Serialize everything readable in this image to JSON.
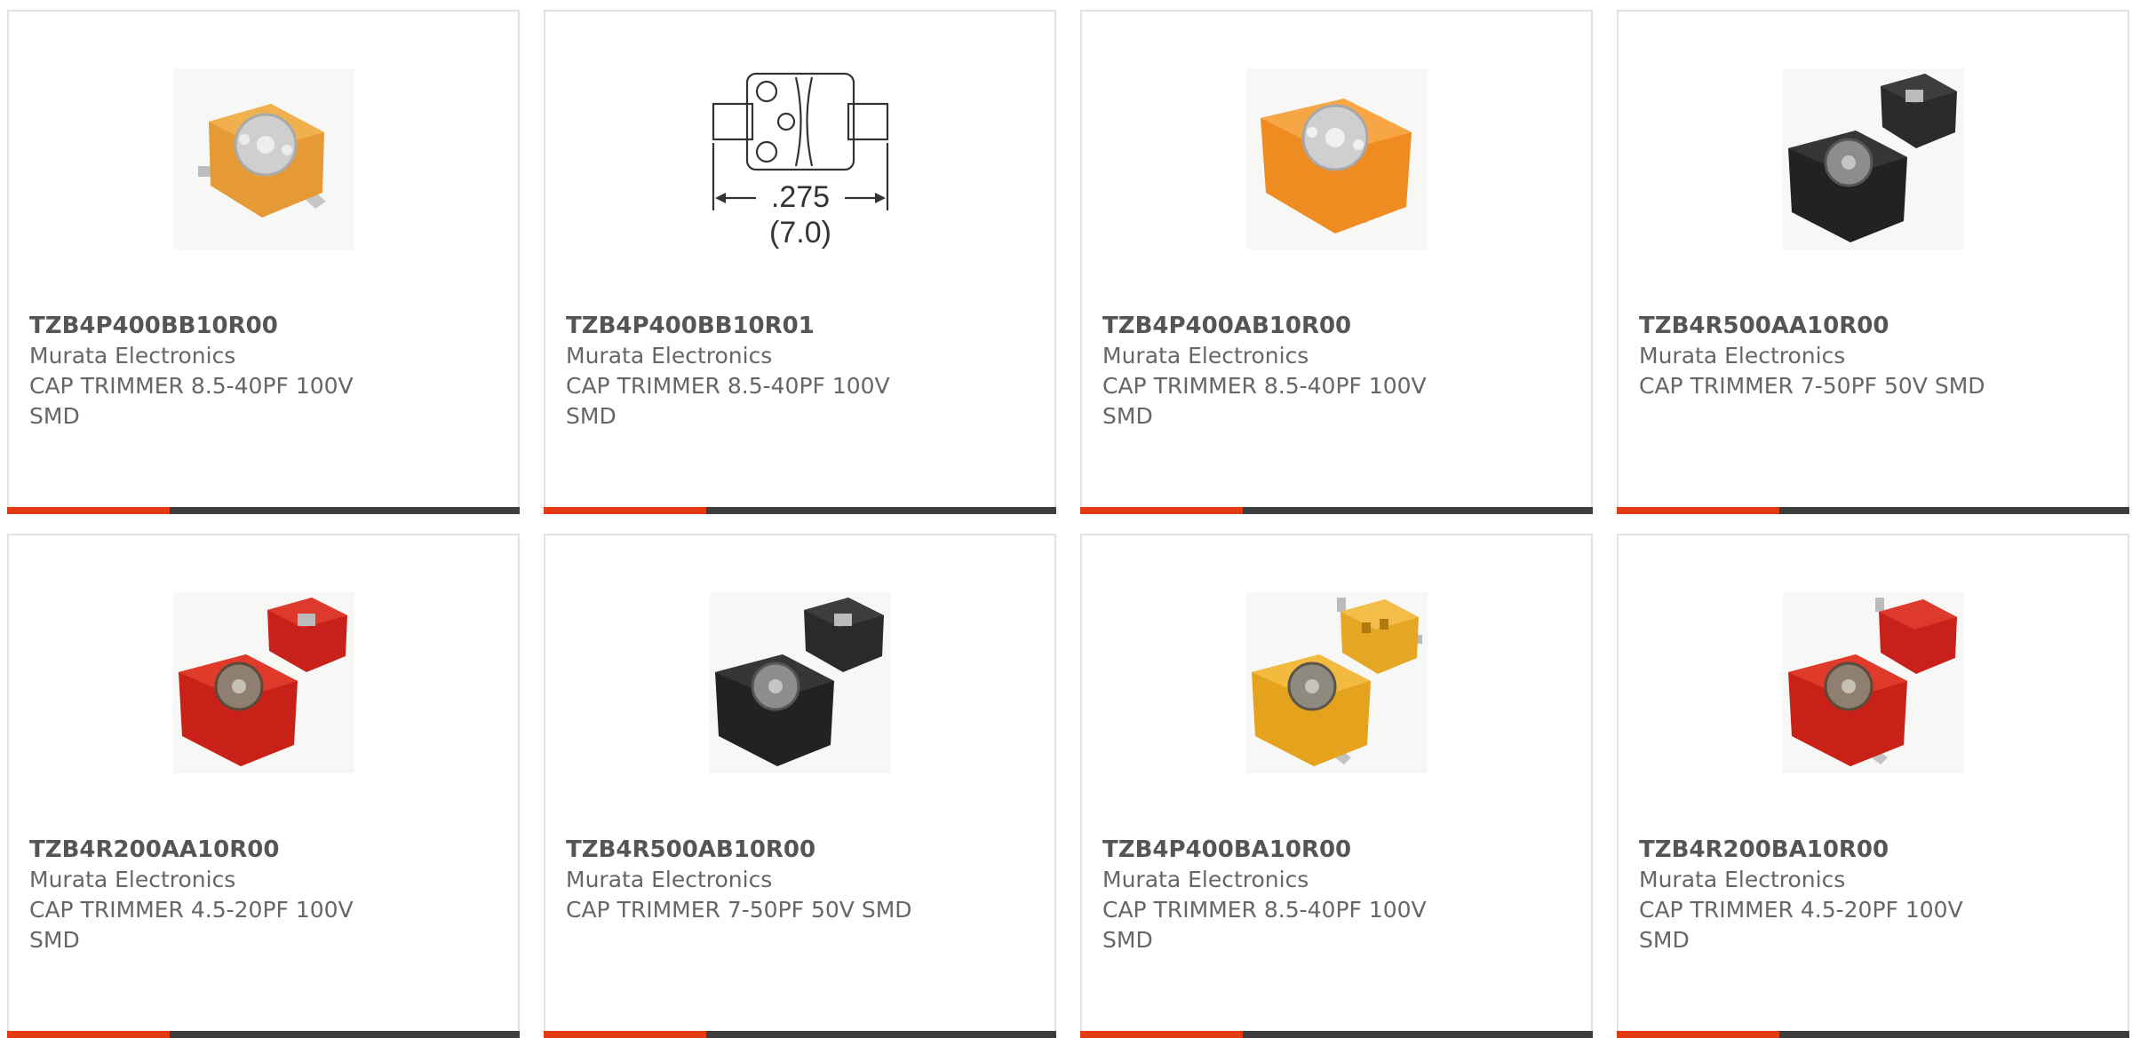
{
  "colors": {
    "accent_red": "#e23a12",
    "accent_dark": "#3d3d3d",
    "text": "#666666",
    "border": "#e2e2e2"
  },
  "products": [
    {
      "part_number": "TZB4P400BB10R00",
      "manufacturer": "Murata Electronics",
      "description": "CAP TRIMMER 8.5-40PF 100V SMD",
      "image": "orange-trimmer-capacitor-photo"
    },
    {
      "part_number": "TZB4P400BB10R01",
      "manufacturer": "Murata Electronics",
      "description": "CAP TRIMMER 8.5-40PF 100V SMD",
      "image": "dimension-drawing",
      "drawing": {
        "dimension": ".275",
        "dimension_mm": "(7.0)"
      }
    },
    {
      "part_number": "TZB4P400AB10R00",
      "manufacturer": "Murata Electronics",
      "description": "CAP TRIMMER 8.5-40PF 100V SMD",
      "image": "orange-trimmer-capacitor-photo"
    },
    {
      "part_number": "TZB4R500AA10R00",
      "manufacturer": "Murata Electronics",
      "description": "CAP TRIMMER 7-50PF 50V SMD",
      "image": "black-trimmer-capacitor-pair-photo"
    },
    {
      "part_number": "TZB4R200AA10R00",
      "manufacturer": "Murata Electronics",
      "description": "CAP TRIMMER 4.5-20PF 100V SMD",
      "image": "red-trimmer-capacitor-pair-photo"
    },
    {
      "part_number": "TZB4R500AB10R00",
      "manufacturer": "Murata Electronics",
      "description": "CAP TRIMMER 7-50PF 50V SMD",
      "image": "black-trimmer-capacitor-pair-photo"
    },
    {
      "part_number": "TZB4P400BA10R00",
      "manufacturer": "Murata Electronics",
      "description": "CAP TRIMMER 8.5-40PF 100V SMD",
      "image": "yellow-trimmer-capacitor-pair-photo"
    },
    {
      "part_number": "TZB4R200BA10R00",
      "manufacturer": "Murata Electronics",
      "description": "CAP TRIMMER 4.5-20PF 100V SMD",
      "image": "red-trimmer-capacitor-pair-photo"
    }
  ]
}
